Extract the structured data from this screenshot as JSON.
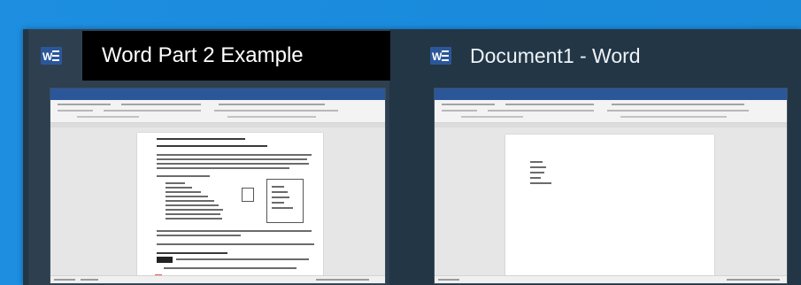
{
  "windows": [
    {
      "title": "Word Part 2 Example",
      "app_icon": "word-icon"
    },
    {
      "title": "Document1 - Word",
      "app_icon": "word-icon"
    }
  ],
  "colors": {
    "desktop": "#1a8bdc",
    "flyout_background": "#233646",
    "tooltip_background": "#000000",
    "word_blue": "#2b579a"
  }
}
